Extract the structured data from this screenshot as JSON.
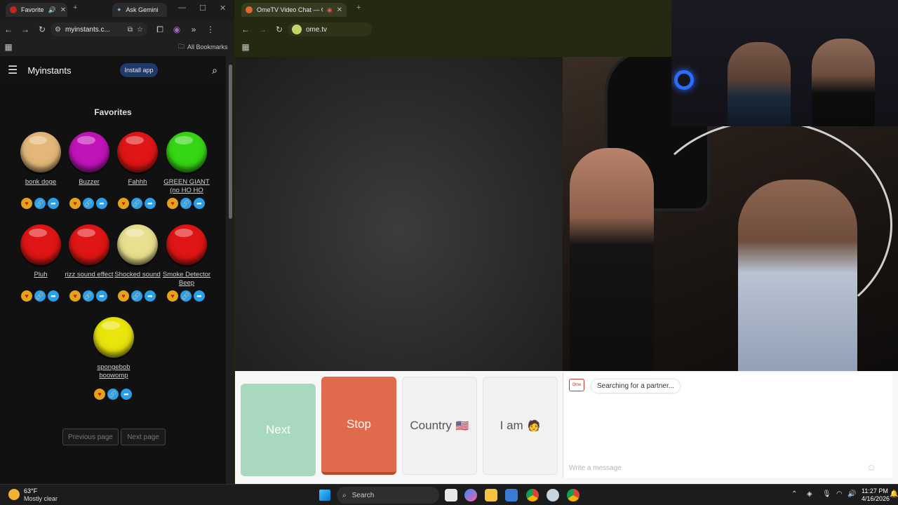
{
  "left_browser": {
    "tabs": [
      {
        "label": "Favorite"
      },
      {
        "label": "Ask Gemini"
      }
    ],
    "address": "myinstants.c...",
    "bookmarks_label": "All Bookmarks"
  },
  "myinstants": {
    "title": "Myinstants",
    "install_label": "Install app",
    "section_title": "Favorites",
    "sounds": [
      {
        "label": "bonk doge",
        "color": "#e3b77a"
      },
      {
        "label": "Buzzer",
        "color": "#c014b9"
      },
      {
        "label": "Fahhh",
        "color": "#e01515"
      },
      {
        "label": "GREEN GIANT (no HO HO",
        "color": "#35d614"
      },
      {
        "label": "Pluh",
        "color": "#e01515"
      },
      {
        "label": "rizz sound effect",
        "color": "#e01515"
      },
      {
        "label": "Shocked sound",
        "color": "#e8e08e"
      },
      {
        "label": "Smoke Detector Beep",
        "color": "#e01515"
      },
      {
        "label": "spongebob boowomp",
        "color": "#e8e40c"
      }
    ],
    "prev_page": "Previous page",
    "next_page": "Next page"
  },
  "right_browser": {
    "tab_label": "OmeTV Video Chat — Ome",
    "address": "ome.tv"
  },
  "ometv": {
    "next_label": "Next",
    "stop_label": "Stop",
    "country_label": "Country",
    "country_flag": "🇺🇸",
    "iam_label": "I am",
    "iam_emoji": "🧑",
    "status_text": "Searching for a partner...",
    "message_placeholder": "Write a message",
    "logo_text": "Ome",
    "colors": {
      "next": "#a8d8be",
      "stop": "#e06a4c",
      "neutral": "#f1f1f1"
    }
  },
  "taskbar": {
    "temperature": "63°F",
    "weather": "Mostly clear",
    "search_placeholder": "Search",
    "time": "11:27 PM",
    "date": "4/16/2026"
  }
}
